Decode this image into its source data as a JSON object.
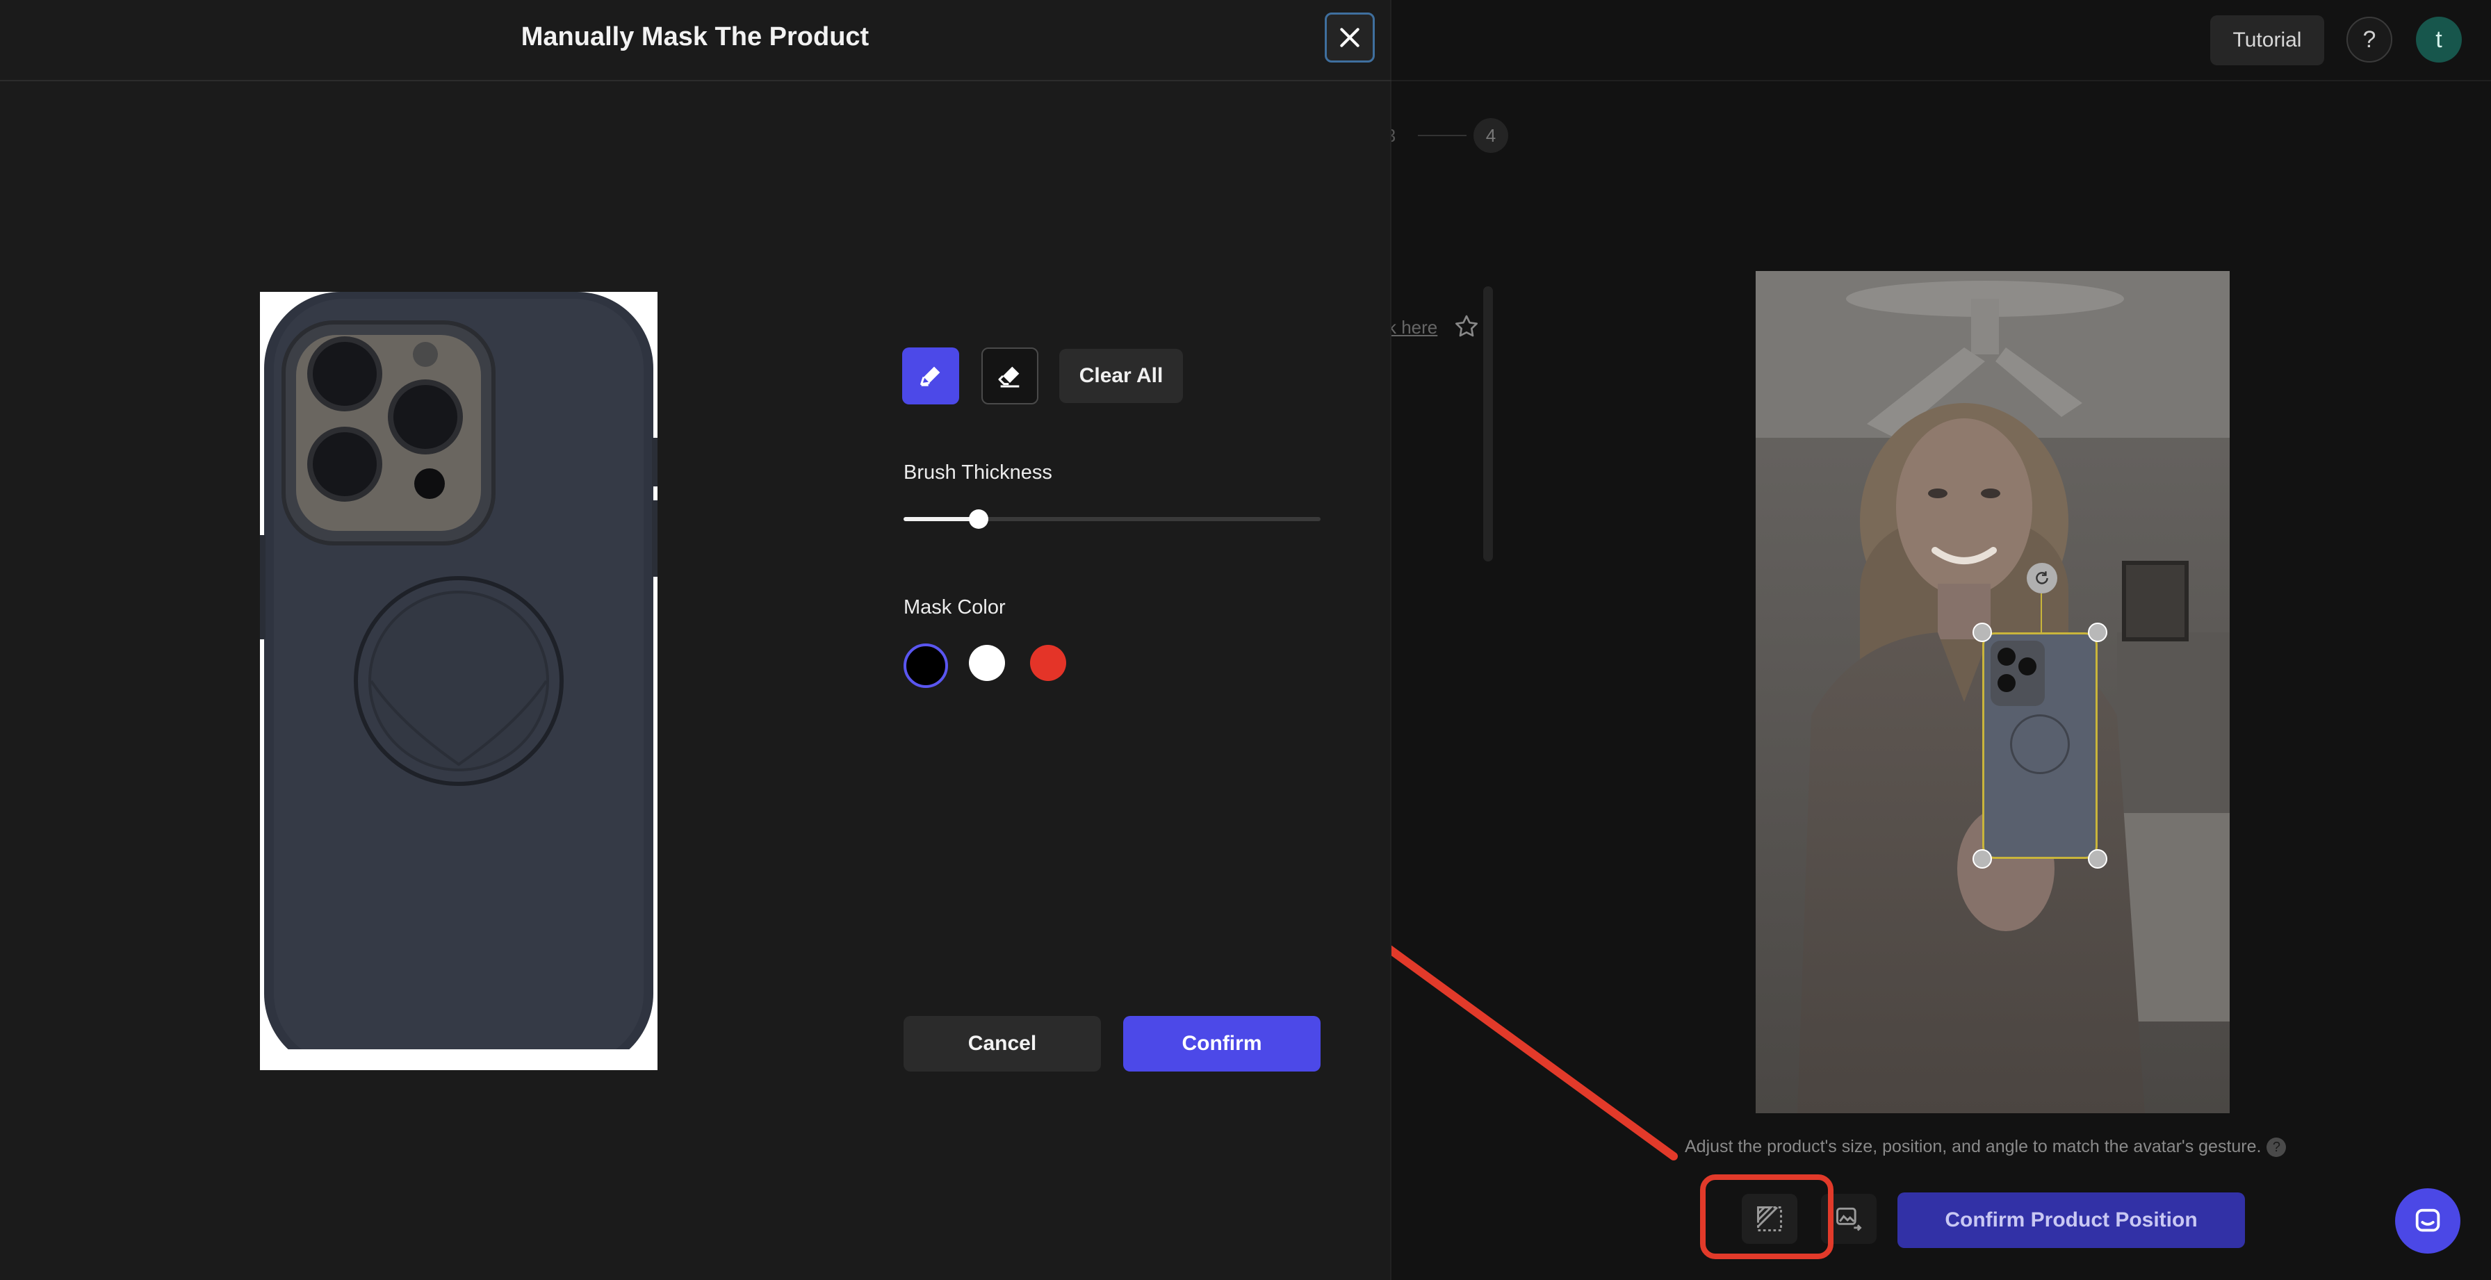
{
  "background": {
    "tutorial_label": "Tutorial",
    "help_label": "?",
    "avatar_initial": "t",
    "step_three": "3",
    "step_four": "4",
    "click_here_link": "k here",
    "hint_text": "Adjust the product's size, position, and angle to match the avatar's gesture.",
    "hint_help": "?",
    "confirm_position_label": "Confirm Product Position"
  },
  "modal": {
    "title": "Manually Mask The Product",
    "clear_all_label": "Clear All",
    "brush_thickness_label": "Brush Thickness",
    "brush_thickness_value": 0.18,
    "mask_color_label": "Mask Color",
    "mask_colors": [
      "#000000",
      "#ffffff",
      "#e43428"
    ],
    "selected_mask_color": "#000000",
    "cancel_label": "Cancel",
    "confirm_label": "Confirm"
  },
  "colors": {
    "accent": "#4c49e8",
    "annotation_red": "#e23a2a"
  },
  "icons": {
    "close": "close-icon",
    "brush": "brush-icon",
    "eraser": "eraser-icon",
    "mask_tool": "mask-tool-icon",
    "replace_image": "replace-image-icon",
    "chat": "chat-icon",
    "star": "star-icon"
  }
}
